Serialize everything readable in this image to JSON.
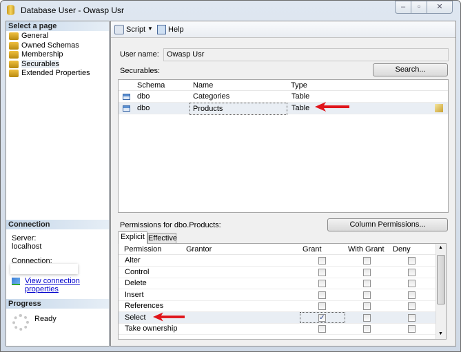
{
  "window": {
    "title": "Database User - Owasp Usr",
    "min": "–",
    "max": "▫",
    "close": "✕"
  },
  "left": {
    "select_header": "Select a page",
    "pages": [
      "General",
      "Owned Schemas",
      "Membership",
      "Securables",
      "Extended Properties"
    ],
    "connection_header": "Connection",
    "server_label": "Server:",
    "server_value": "localhost",
    "connection_label": "Connection:",
    "view_link": "View connection properties",
    "progress_header": "Progress",
    "progress_status": "Ready"
  },
  "toolbar": {
    "script": "Script",
    "help": "Help"
  },
  "main": {
    "user_name_label": "User name:",
    "user_name_value": "Owasp Usr",
    "securables_label": "Securables:",
    "search_button": "Search...",
    "securables_columns": [
      "Schema",
      "Name",
      "Type"
    ],
    "securables_rows": [
      {
        "schema": "dbo",
        "name": "Categories",
        "type": "Table"
      },
      {
        "schema": "dbo",
        "name": "Products",
        "type": "Table"
      }
    ],
    "permissions_label": "Permissions for dbo.Products:",
    "column_permissions_button": "Column Permissions...",
    "tabs": [
      "Explicit",
      "Effective"
    ],
    "perm_columns": [
      "Permission",
      "Grantor",
      "Grant",
      "With Grant",
      "Deny"
    ],
    "perm_rows": [
      {
        "permission": "Alter",
        "grantor": "",
        "grant": false,
        "with_grant": false,
        "deny": false
      },
      {
        "permission": "Control",
        "grantor": "",
        "grant": false,
        "with_grant": false,
        "deny": false
      },
      {
        "permission": "Delete",
        "grantor": "",
        "grant": false,
        "with_grant": false,
        "deny": false
      },
      {
        "permission": "Insert",
        "grantor": "",
        "grant": false,
        "with_grant": false,
        "deny": false
      },
      {
        "permission": "References",
        "grantor": "",
        "grant": false,
        "with_grant": false,
        "deny": false
      },
      {
        "permission": "Select",
        "grantor": "",
        "grant": true,
        "with_grant": false,
        "deny": false
      },
      {
        "permission": "Take ownership",
        "grantor": "",
        "grant": false,
        "with_grant": false,
        "deny": false
      }
    ]
  },
  "colors": {
    "annotation_arrow": "#e0141a",
    "link": "#0000cc"
  }
}
